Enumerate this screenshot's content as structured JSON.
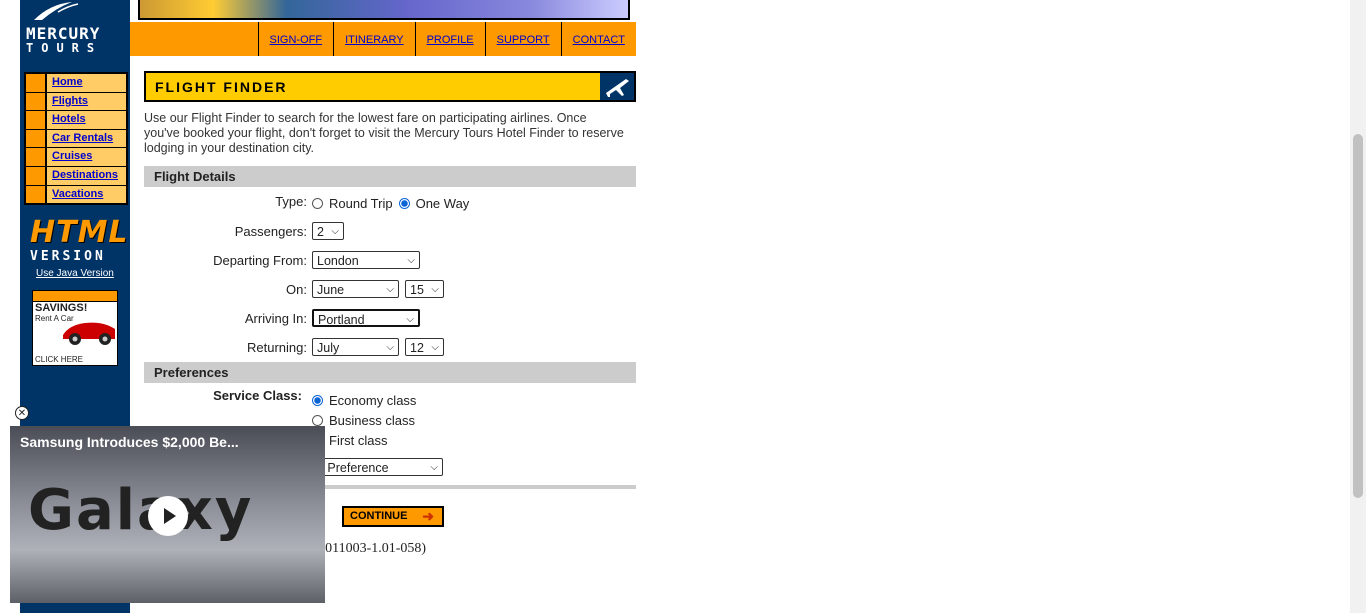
{
  "logo": {
    "line1": "MERCURY",
    "line2": "TOURS"
  },
  "sidebar": {
    "items": [
      {
        "label": "Home"
      },
      {
        "label": "Flights"
      },
      {
        "label": "Hotels"
      },
      {
        "label": "Car Rentals"
      },
      {
        "label": "Cruises"
      },
      {
        "label": "Destinations"
      },
      {
        "label": "Vacations"
      }
    ],
    "html_version": "HTML",
    "version_word": "VERSION",
    "java_link": "Use Java Version",
    "ad": {
      "headline": "SAVINGS!",
      "sub": "Rent A Car",
      "cta": "CLICK HERE"
    }
  },
  "topnav": {
    "links": [
      "SIGN-OFF",
      "ITINERARY",
      "PROFILE",
      "SUPPORT",
      "CONTACT"
    ]
  },
  "header": {
    "title": "FLIGHT FINDER"
  },
  "intro": "Use our Flight Finder to search for the lowest fare on participating airlines. Once you've booked your flight, don't forget to visit the Mercury Tours Hotel Finder to reserve lodging in your destination city.",
  "flight_details": {
    "section_title": "Flight Details",
    "type_label": "Type:",
    "type_options": [
      "Round Trip",
      "One Way"
    ],
    "type_selected": "One Way",
    "passengers_label": "Passengers:",
    "passengers_value": "2",
    "departing_label": "Departing From:",
    "departing_value": "London",
    "on_label": "On:",
    "on_month": "June",
    "on_day": "15",
    "arriving_label": "Arriving In:",
    "arriving_value": "Portland",
    "returning_label": "Returning:",
    "returning_month": "July",
    "returning_day": "12"
  },
  "preferences": {
    "section_title": "Preferences",
    "service_label": "Service Class:",
    "service_options": [
      "Economy class",
      "Business class",
      "First class"
    ],
    "service_selected": "Economy class",
    "airline_value": "o Preference"
  },
  "continue_label": "CONTINUE",
  "revision": "v. 011003-1.01-058)",
  "video": {
    "title": "Samsung Introduces $2,000 Be...",
    "overlay_word": "Galaxy"
  }
}
